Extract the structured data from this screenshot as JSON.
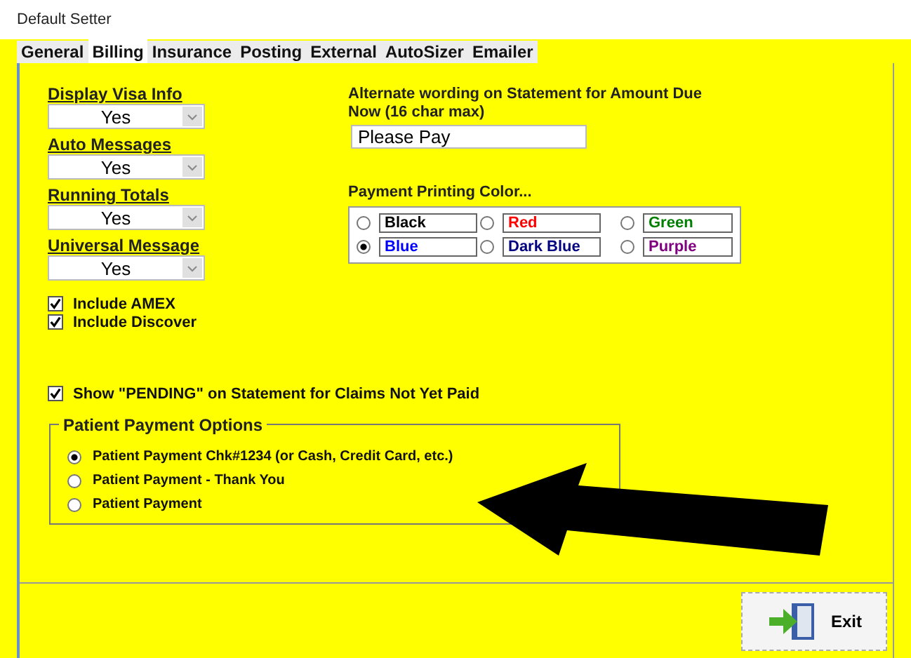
{
  "window": {
    "title": "Default Setter"
  },
  "tabs": [
    {
      "label": "General",
      "selected": false
    },
    {
      "label": "Billing",
      "selected": true
    },
    {
      "label": "Insurance",
      "selected": false
    },
    {
      "label": "Posting",
      "selected": false
    },
    {
      "label": "External",
      "selected": false
    },
    {
      "label": "AutoSizer",
      "selected": false
    },
    {
      "label": "Emailer",
      "selected": false
    }
  ],
  "dropdowns": [
    {
      "label": "Display Visa Info",
      "value": "Yes"
    },
    {
      "label": "Auto Messages",
      "value": "Yes"
    },
    {
      "label": "Running Totals",
      "value": "Yes"
    },
    {
      "label": "Universal Message",
      "value": "Yes"
    }
  ],
  "card_checkboxes": [
    {
      "label": "Include AMEX",
      "checked": true
    },
    {
      "label": "Include Discover",
      "checked": true
    }
  ],
  "alternate_wording": {
    "label": "Alternate wording on Statement for Amount Due Now (16 char max)",
    "value": "Please Pay"
  },
  "payment_color": {
    "label": "Payment Printing Color...",
    "options": [
      {
        "label": "Black",
        "color": "#000000",
        "selected": false
      },
      {
        "label": "Red",
        "color": "#ff0000",
        "selected": false
      },
      {
        "label": "Green",
        "color": "#008000",
        "selected": false
      },
      {
        "label": "Blue",
        "color": "#0000ff",
        "selected": true
      },
      {
        "label": "Dark Blue",
        "color": "#000080",
        "selected": false
      },
      {
        "label": "Purple",
        "color": "#800080",
        "selected": false
      }
    ]
  },
  "pending_checkbox": {
    "label": "Show \"PENDING\" on Statement for Claims Not Yet Paid",
    "checked": true
  },
  "patient_payment": {
    "title": "Patient Payment Options",
    "options": [
      {
        "label": "Patient Payment Chk#1234 (or Cash, Credit Card, etc.)",
        "selected": true
      },
      {
        "label": "Patient Payment - Thank You",
        "selected": false
      },
      {
        "label": "Patient Payment",
        "selected": false
      }
    ]
  },
  "buttons": [
    {
      "label": "Exit"
    }
  ]
}
